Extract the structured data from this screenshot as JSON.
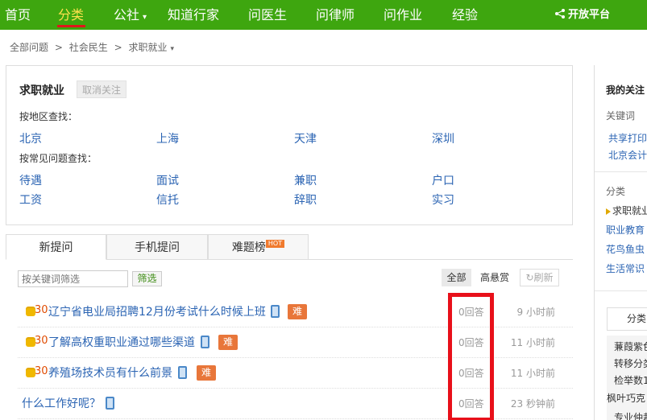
{
  "nav": {
    "items": [
      {
        "label": "首页"
      },
      {
        "label": "分类"
      },
      {
        "label": "公社"
      },
      {
        "label": "知道行家"
      },
      {
        "label": "问医生"
      },
      {
        "label": "问律师"
      },
      {
        "label": "问作业"
      },
      {
        "label": "经验"
      }
    ],
    "open_platform": "开放平台"
  },
  "breadcrumb": [
    "全部问题",
    ">",
    "社会民生",
    ">",
    "求职就业"
  ],
  "category": {
    "title": "求职就业",
    "unfollow": "取消关注",
    "by_region_label": "按地区查找：",
    "cities": [
      "北京",
      "上海",
      "天津",
      "深圳"
    ],
    "by_topic_label": "按常见问题查找：",
    "topics": [
      "待遇",
      "面试",
      "兼职",
      "户口",
      "工资",
      "信托",
      "辞职",
      "实习"
    ]
  },
  "tabs": [
    {
      "label": "新提问"
    },
    {
      "label": "手机提问"
    },
    {
      "label": "难题榜",
      "badge": "HOT"
    }
  ],
  "filter": {
    "placeholder": "按关键词筛选",
    "button": "筛选",
    "sort_all": "全部",
    "sort_bounty": "高悬赏",
    "refresh": "刷新"
  },
  "questions": [
    {
      "reward": "30",
      "title": "辽宁省电业局招聘12月份考试什么时候上班",
      "hard": "难",
      "answers": "0回答",
      "time": "9 小时前"
    },
    {
      "reward": "30",
      "title": "了解高权重职业通过哪些渠道",
      "hard": "难",
      "answers": "0回答",
      "time": "11 小时前"
    },
    {
      "reward": "30",
      "title": "养殖场技术员有什么前景",
      "hard": "难",
      "answers": "0回答",
      "time": "11 小时前"
    },
    {
      "reward": "",
      "title": "什么工作好呢？",
      "hard": "",
      "answers": "0回答",
      "time": "23 秒钟前"
    }
  ],
  "sidebar": {
    "my_follow": "我的关注",
    "keywords_label": "关键词",
    "keywords": [
      "共享打印",
      "北京会计"
    ],
    "category_label": "分类",
    "categories": [
      "求职就业",
      "职业教育",
      "花鸟鱼虫",
      "生活常识"
    ],
    "tab_label": "分类",
    "list": [
      "蒹葭紫色",
      "转移分类",
      "检举数1",
      "枫叶巧克",
      "专业仲裁"
    ]
  },
  "colors": {
    "nav_bg": "#3ea60f",
    "link": "#2b64b3",
    "hard_badge": "#e8763a",
    "highlight_box": "#e8101a"
  }
}
